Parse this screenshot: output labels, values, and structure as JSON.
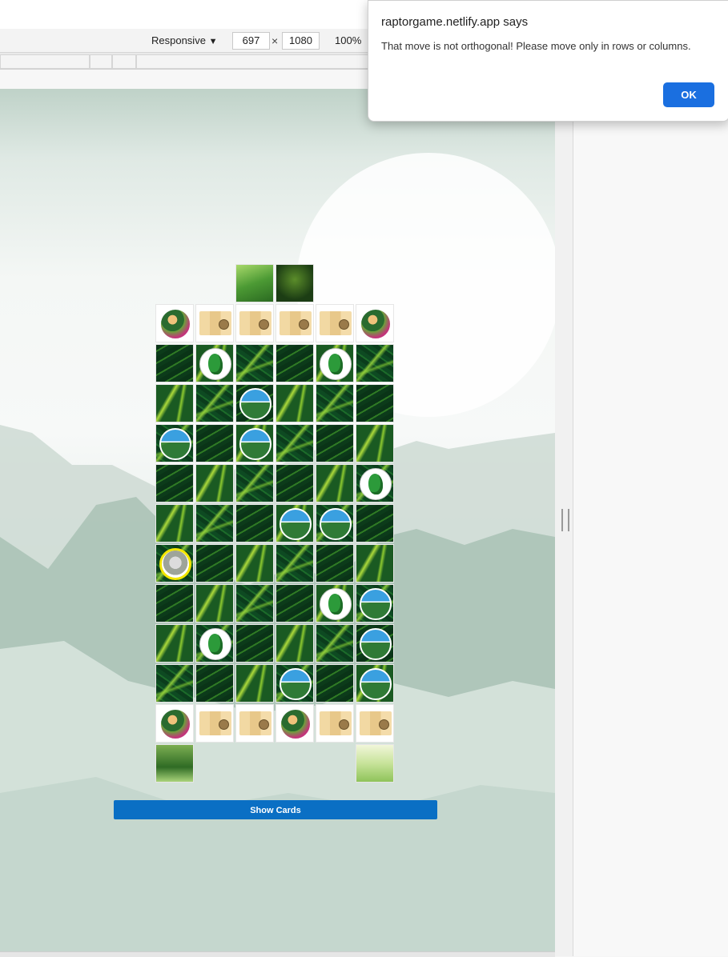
{
  "devtools": {
    "device_label": "Responsive",
    "device_caret": "▼",
    "width_value": "697",
    "times": "×",
    "height_value": "1080",
    "zoom_label": "100%"
  },
  "alert": {
    "title": "raptorgame.netlify.app says",
    "message": "That move is not orthogonal! Please move only in rows or columns.",
    "ok_label": "OK"
  },
  "game": {
    "show_cards_label": "Show Cards",
    "board": {
      "top_extras": [
        "photo",
        "photo2"
      ],
      "rows": [
        [
          "explorer",
          "map",
          "map",
          "map",
          "map",
          "explorer"
        ],
        [
          "jungle",
          "raptor",
          "jungle",
          "jungle",
          "raptor",
          "jungle"
        ],
        [
          "jungle",
          "jungle",
          "mountain",
          "jungle",
          "jungle",
          "jungle"
        ],
        [
          "mountain",
          "jungle",
          "mountain",
          "jungle",
          "jungle",
          "jungle"
        ],
        [
          "jungle",
          "jungle",
          "jungle",
          "jungle",
          "jungle",
          "raptor"
        ],
        [
          "jungle",
          "jungle",
          "jungle",
          "mountain",
          "mountain",
          "jungle"
        ],
        [
          "hidden-raptor",
          "jungle",
          "jungle",
          "jungle",
          "jungle",
          "jungle"
        ],
        [
          "jungle",
          "jungle",
          "jungle",
          "jungle",
          "raptor",
          "mountain"
        ],
        [
          "jungle",
          "raptor",
          "jungle",
          "jungle",
          "jungle",
          "mountain"
        ],
        [
          "jungle",
          "jungle",
          "jungle",
          "mountain",
          "jungle",
          "mountain"
        ],
        [
          "explorer",
          "map",
          "map",
          "explorer",
          "map",
          "map"
        ]
      ],
      "bottom_extras": [
        "photo3",
        "photo4"
      ]
    }
  }
}
